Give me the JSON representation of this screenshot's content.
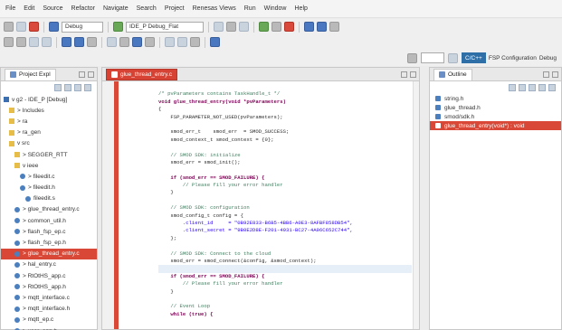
{
  "menu": [
    "File",
    "Edit",
    "Source",
    "Refactor",
    "Navigate",
    "Search",
    "Project",
    "Renesas Views",
    "Run",
    "Window",
    "Help"
  ],
  "toolbar": {
    "build_config": "Debug",
    "launch_target": "IDE_P Debug_Flat"
  },
  "perspectives": {
    "active": "C/C++",
    "other": "FSP Configuration",
    "debug": "Debug"
  },
  "explorer": {
    "tab_title": "Project Expl",
    "items": [
      "v g2 - IDE_P [Debug]",
      "  > Includes",
      "  > ra",
      "  > ra_gen",
      "  v src",
      "    > SEGGER_RTT",
      "    v ieee",
      "      > fileedit.c",
      "      > fileedit.h",
      "        fileedit.s",
      "    > glue_thread_entry.c",
      "    > common_util.h",
      "    > flash_fsp_ep.c",
      "    > flash_fsp_ep.h",
      "    > glue_thread_entry.c",
      "    > hal_entry.c",
      "    > RtOtHS_app.c",
      "    > RtOtHS_app.h",
      "    > mqtt_interface.c",
      "    > mqtt_interface.h",
      "    > mqtt_ep.c",
      "    > user_app.h"
    ],
    "selected_index": 14
  },
  "editor": {
    "tab_title": "glue_thread_entry.c",
    "lines": [
      {
        "t": "",
        "c": ""
      },
      {
        "t": "/* pvParameters contains TaskHandle_t */",
        "c": "cm"
      },
      {
        "t": "void glue_thread_entry(void *pvParameters)",
        "c": "kw"
      },
      {
        "t": "{",
        "c": ""
      },
      {
        "t": "    FSP_PARAMETER_NOT_USED(pvParameters);",
        "c": ""
      },
      {
        "t": "",
        "c": ""
      },
      {
        "t": "    smod_err_t    smod_err  = SMOD_SUCCESS;",
        "c": ""
      },
      {
        "t": "    smod_context_t smod_context = {0};",
        "c": ""
      },
      {
        "t": "",
        "c": ""
      },
      {
        "t": "    // SMOD SDK: initialize",
        "c": "cm"
      },
      {
        "t": "    smod_err = smod_init();",
        "c": ""
      },
      {
        "t": "",
        "c": ""
      },
      {
        "t": "    if (smod_err == SMOD_FAILURE) {",
        "c": "kw"
      },
      {
        "t": "        // Please fill your error handler",
        "c": "cm"
      },
      {
        "t": "    }",
        "c": ""
      },
      {
        "t": "",
        "c": ""
      },
      {
        "t": "    // SMOD SDK: configuration",
        "c": "cm"
      },
      {
        "t": "    smod_config_t config = {",
        "c": ""
      },
      {
        "t": "        .client_id     = \"0B92E833-B6B5-4BB6-A0E3-8AFBF858DB54\",",
        "c": "str"
      },
      {
        "t": "        .client_secret = \"9B0E2D8E-F201-4931-BC27-4A96C652C744\",",
        "c": "str"
      },
      {
        "t": "    };",
        "c": ""
      },
      {
        "t": "",
        "c": ""
      },
      {
        "t": "    // SMOD SDK: Connect to the cloud",
        "c": "cm"
      },
      {
        "t": "    smod_err = smod_connect(&config, &smod_context);",
        "c": ""
      },
      {
        "t": "",
        "c": ""
      },
      {
        "t": "    if (smod_err == SMOD_FAILURE) {",
        "c": "kw"
      },
      {
        "t": "        // Please fill your error handler",
        "c": "cm"
      },
      {
        "t": "    }",
        "c": ""
      },
      {
        "t": "",
        "c": ""
      },
      {
        "t": "    // Event Loop",
        "c": "cm"
      },
      {
        "t": "    while (true) {",
        "c": "kw"
      },
      {
        "t": "",
        "c": ""
      },
      {
        "t": "",
        "c": ""
      },
      {
        "t": "",
        "c": ""
      }
    ],
    "highlight_line": 24
  },
  "outline": {
    "tab_title": "Outline",
    "items": [
      "string.h",
      "glue_thread.h",
      "smod/sdk.h",
      "glue_thread_entry(void*) : void"
    ],
    "selected_index": 3
  },
  "colors": {
    "accent": "#d94836",
    "perspective_active": "#2f6fa8"
  }
}
